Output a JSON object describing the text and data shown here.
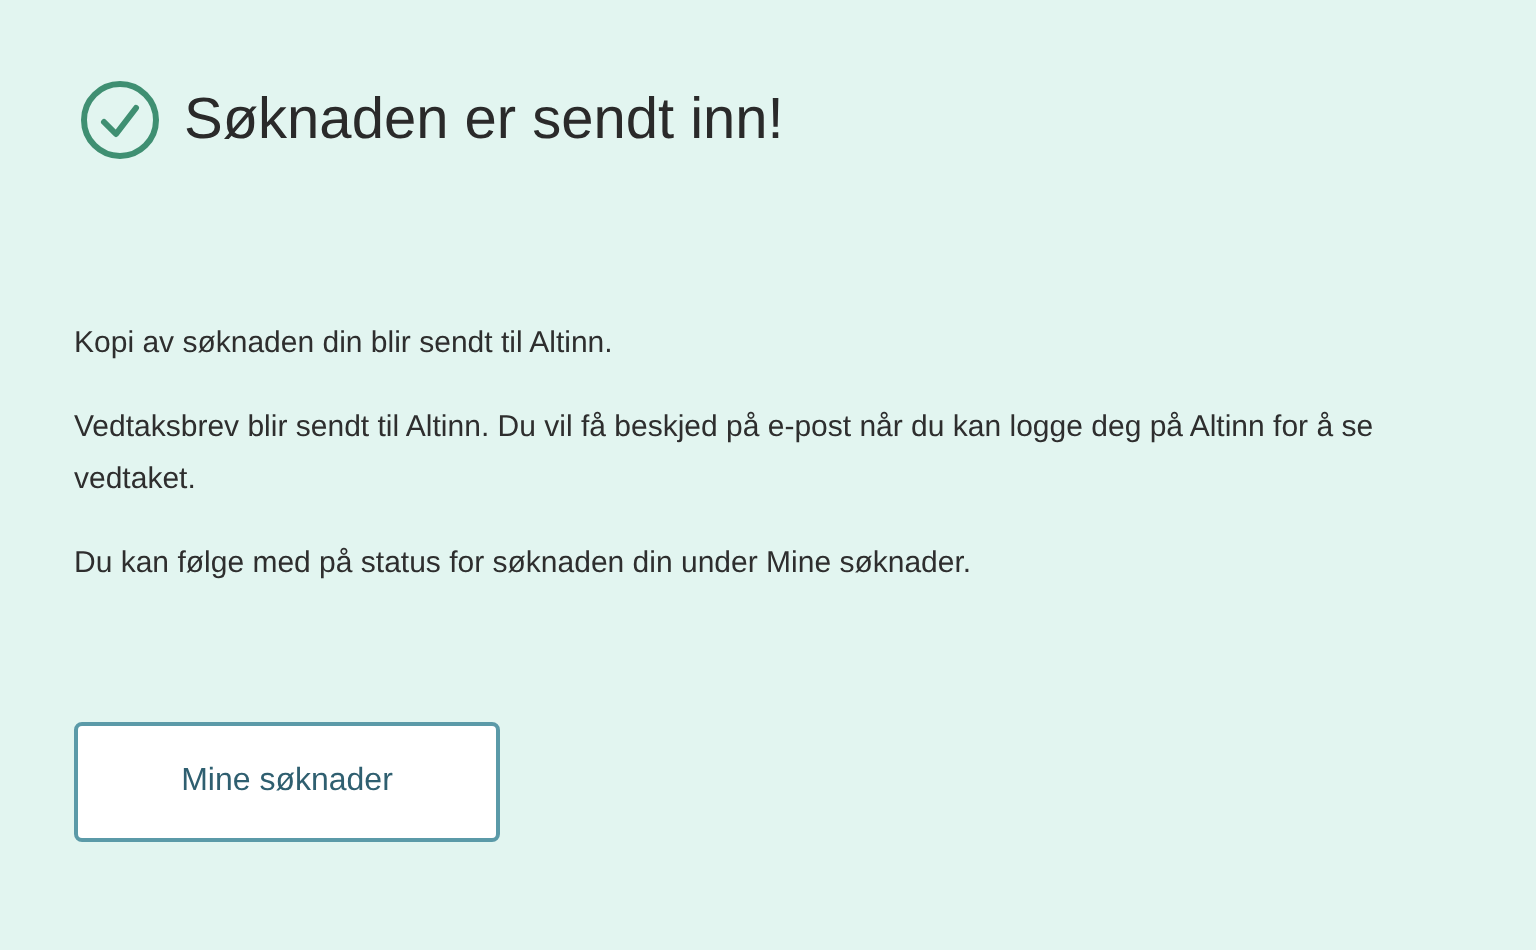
{
  "heading": "Søknaden er sendt inn!",
  "paragraphs": [
    "Kopi av søknaden din blir sendt til Altinn.",
    "Vedtaksbrev blir sendt til Altinn. Du vil få beskjed på e-post når du kan logge deg på Altinn for å se vedtaket.",
    "Du kan følge med på status for søknaden din under Mine søknader."
  ],
  "button": {
    "label": "Mine søknader"
  }
}
